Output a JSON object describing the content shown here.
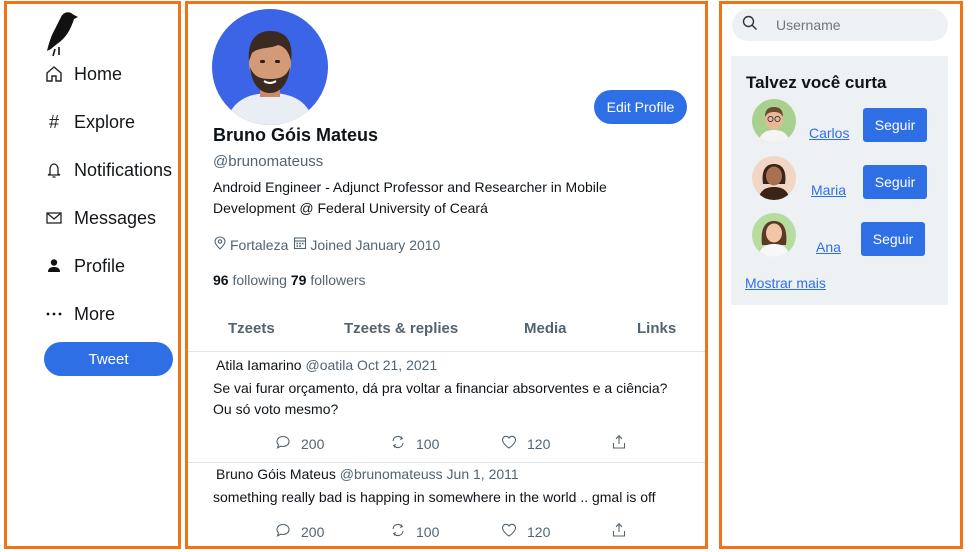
{
  "nav": {
    "items": [
      {
        "label": "Home",
        "icon": "home-icon"
      },
      {
        "label": "Explore",
        "icon": "hashtag-icon"
      },
      {
        "label": "Notifications",
        "icon": "bell-icon"
      },
      {
        "label": "Messages",
        "icon": "envelope-icon"
      },
      {
        "label": "Profile",
        "icon": "person-icon"
      },
      {
        "label": "More",
        "icon": "more-dots-icon"
      }
    ],
    "tweet_button": "Tweet"
  },
  "profile": {
    "edit_button": "Edit Profile",
    "name": "Bruno Góis Mateus",
    "handle": "@brunomateuss",
    "bio": "Android Engineer - Adjunct Professor and Researcher in Mobile Development @ Federal University of Ceará",
    "location": "Fortaleza",
    "joined": "Joined January 2010",
    "following_count": "96",
    "following_label": "following",
    "followers_count": "79",
    "followers_label": "followers"
  },
  "tabs": [
    "Tzeets",
    "Tzeets & replies",
    "Media",
    "Links"
  ],
  "tweets": [
    {
      "author": "Atila Iamarino",
      "handle_date": "@oatila Oct 21, 2021",
      "text": "Se vai furar orçamento, dá pra voltar a financiar absorventes e a ciência? Ou só voto mesmo?",
      "replies": "200",
      "retweets": "100",
      "likes": "120"
    },
    {
      "author": "Bruno Góis Mateus",
      "handle_date": "@brunomateuss Jun 1, 2011",
      "text": "something really bad is happing in somewhere in the world .. gmal is off",
      "replies": "200",
      "retweets": "100",
      "likes": "120"
    }
  ],
  "search": {
    "placeholder": "Username"
  },
  "suggestions": {
    "title": "Talvez você curta",
    "users": [
      {
        "name": "Carlos",
        "button": "Seguir"
      },
      {
        "name": "Maria",
        "button": "Seguir"
      },
      {
        "name": "Ana",
        "button": "Seguir"
      }
    ],
    "show_more": "Mostrar mais"
  },
  "colors": {
    "accent": "#2f6fe6",
    "border": "#f07318",
    "panel": "#eef1f4"
  }
}
